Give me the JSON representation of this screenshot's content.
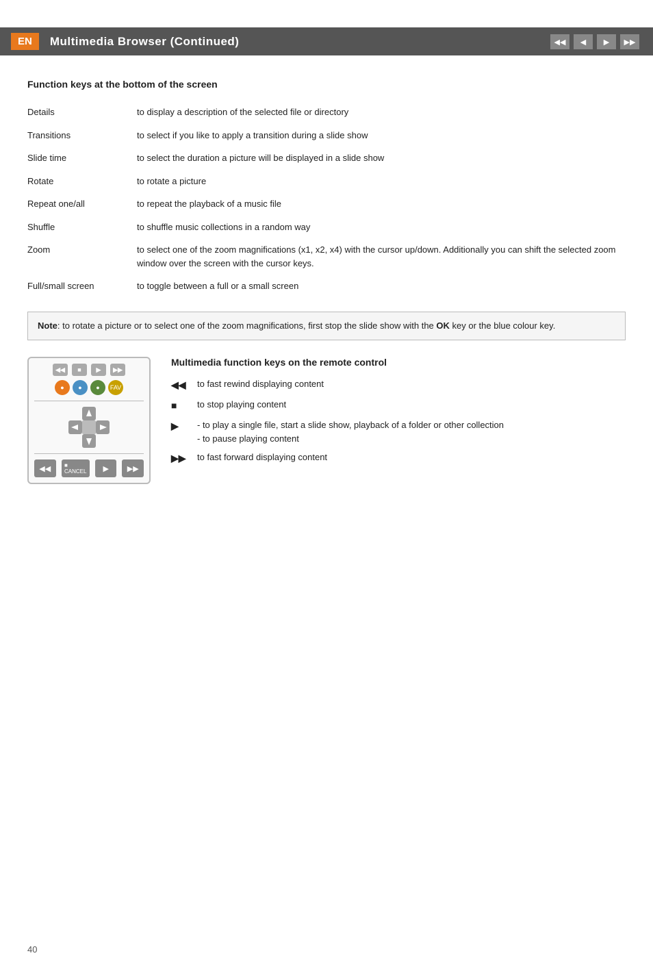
{
  "header": {
    "lang": "EN",
    "title": "Multimedia Browser  (Continued)"
  },
  "nav_buttons": [
    "◀◀",
    "◀",
    "▶",
    "▶▶"
  ],
  "section1": {
    "heading": "Function keys at the bottom of the screen",
    "rows": [
      {
        "key": "Details",
        "desc": "to display a description of the selected file or directory"
      },
      {
        "key": "Transitions",
        "desc": "to select if you like to apply a transition during a slide show"
      },
      {
        "key": "Slide time",
        "desc": "to select the duration a picture will be displayed in a slide show"
      },
      {
        "key": "Rotate",
        "desc": "to rotate a picture"
      },
      {
        "key": "Repeat one/all",
        "desc": "to repeat the playback of a music file"
      },
      {
        "key": "Shuffle",
        "desc": "to shuffle music collections in a random way"
      },
      {
        "key": "Zoom",
        "desc": "to select one of the zoom magnifications (x1, x2, x4) with the cursor up/down. Additionally you can shift the selected zoom window over the screen with the cursor keys."
      },
      {
        "key": "Full/small screen",
        "desc": "to toggle between a full or a small screen"
      }
    ]
  },
  "note": {
    "label": "Note",
    "text": ": to rotate a picture or to select one of the zoom magnifications, first stop the slide show with the ",
    "bold_word": "OK",
    "text2": " key or the blue colour key."
  },
  "section2": {
    "heading": "Multimedia function keys on the remote control",
    "items": [
      {
        "icon": "◀◀",
        "desc": "to fast rewind displaying content"
      },
      {
        "icon": "■",
        "desc": "to stop playing content"
      },
      {
        "icon": "▶",
        "desc": "- to play a single file, start a slide show, playback of a folder or other collection\n- to pause playing content"
      },
      {
        "icon": "▶▶",
        "desc": "to fast forward displaying content"
      }
    ]
  },
  "page_number": "40"
}
